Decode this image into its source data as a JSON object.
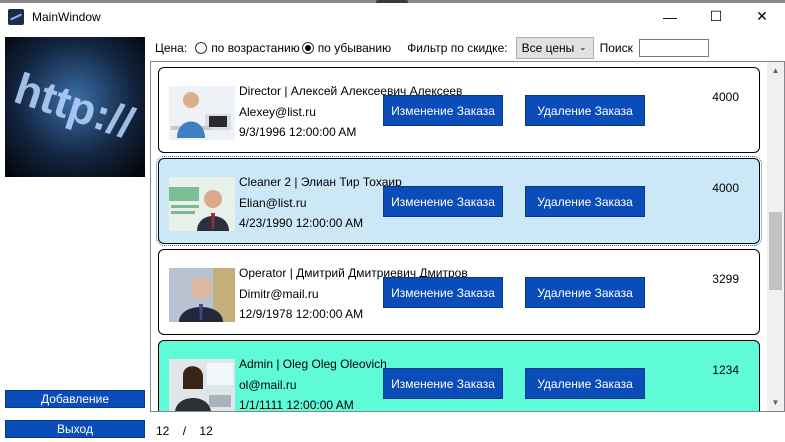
{
  "window": {
    "title": "MainWindow",
    "controls": {
      "minimize": "—",
      "maximize": "☐",
      "close": "✕"
    }
  },
  "sidebar": {
    "image_icon": "http-banner-image",
    "image_text": "http://",
    "add_button": "Добавление",
    "exit_button": "Выход"
  },
  "filters": {
    "price_label": "Цена:",
    "sort_options": [
      {
        "label": "по возрастанию",
        "checked": false
      },
      {
        "label": "по убыванию",
        "checked": true
      }
    ],
    "discount_label": "Фильтр по скидке:",
    "discount_value": "Все цены",
    "search_label": "Поиск",
    "search_value": ""
  },
  "cards": [
    {
      "name": "Director | Алексей Алексеевич Алексеев",
      "email": "Alexey@list.ru",
      "date": "9/3/1996 12:00:00 AM",
      "cost": "4000",
      "edit_label": "Изменение Заказа",
      "delete_label": "Удаление Заказа",
      "background": "#ffffff",
      "photo": "office-man-photo"
    },
    {
      "name": "Cleaner 2 | Элиан Тир Тохаир",
      "email": "Elian@list.ru",
      "date": "4/23/1990 12:00:00 AM",
      "cost": "4000",
      "edit_label": "Изменение Заказа",
      "delete_label": "Удаление Заказа",
      "background": "#cce8f7",
      "photo": "bank-man-photo"
    },
    {
      "name": "Operator | Дмитрий Дмитриевич Дмитров",
      "email": "Dimitr@mail.ru",
      "date": "12/9/1978 12:00:00 AM",
      "cost": "3299",
      "edit_label": "Изменение Заказа",
      "delete_label": "Удаление Заказа",
      "background": "#ffffff",
      "photo": "man-suit-photo"
    },
    {
      "name": "Admin | Oleg Oleg Oleovich",
      "email": "ol@mail.ru",
      "date": "1/1/1111 12:00:00 AM",
      "cost": "1234",
      "edit_label": "Изменение Заказа",
      "delete_label": "Удаление Заказа",
      "background": "#5ffbd9",
      "photo": "woman-office-photo"
    }
  ],
  "pager": {
    "current": "12",
    "separator": "/",
    "total": "12"
  },
  "colors": {
    "accent_button": "#0b4db8",
    "selected_row": "#cce8f7",
    "admin_row": "#5ffbd9"
  }
}
